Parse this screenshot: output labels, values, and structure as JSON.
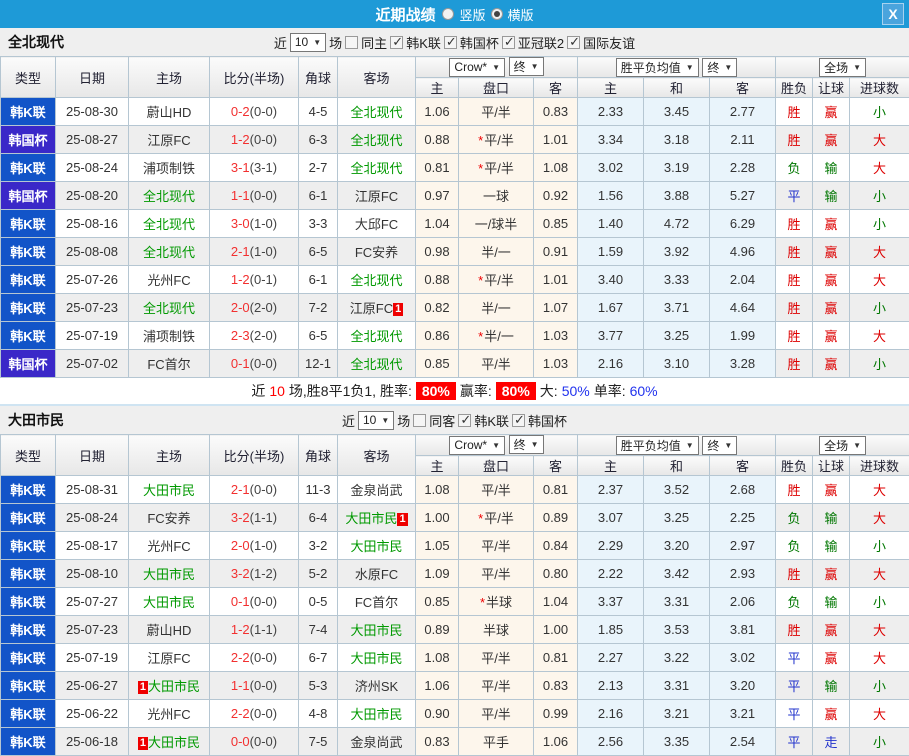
{
  "titlebar": {
    "title": "近期战绩",
    "radio_vertical": "竖版",
    "radio_horizontal": "横版",
    "close_glyph": "X"
  },
  "colors": {
    "titlebar_bg": "#1e9ad7",
    "league_regular": "#1254c8",
    "league_cup": "#3a28c8",
    "target_team": "#009900",
    "score_red": "#f23030",
    "odds_col_bg": "#fdf6ec",
    "mean_col_bg": "#e9f4fb",
    "badge_red": "#ee0000"
  },
  "result_colors": {
    "胜": "#dd0000",
    "负": "#007700",
    "平": "#2233cc",
    "赢": "#dd0000",
    "输": "#007700",
    "走": "#2233cc",
    "大": "#dd0000",
    "小": "#007700"
  },
  "controls": {
    "near": "近",
    "games_value": "10",
    "games": "场",
    "bookmaker": "Crow*",
    "final": "终",
    "mean_label": "胜平负均值",
    "final2": "终",
    "fullmatch": "全场"
  },
  "columns": {
    "type": "类型",
    "date": "日期",
    "home": "主场",
    "score": "比分(半场)",
    "corner": "角球",
    "away": "客场",
    "odds_home": "主",
    "handicap": "盘口",
    "odds_away": "客",
    "mean_home": "主",
    "mean_draw": "和",
    "mean_away": "客",
    "result": "胜负",
    "handicap_result": "让球",
    "goals": "进球数"
  },
  "sections": [
    {
      "team": "全北现代",
      "same_label": "同主",
      "filters": [
        "韩K联",
        "韩国杯",
        "亚冠联2",
        "国际友谊"
      ],
      "rows": [
        {
          "cup": false,
          "league": "韩K联",
          "date": "25-08-30",
          "home": "蔚山HD",
          "home_t": false,
          "score": "0-2",
          "half": "(0-0)",
          "corners": "4-5",
          "away": "全北现代",
          "away_t": true,
          "o1": "1.06",
          "star": false,
          "pan": "平/半",
          "o2": "0.83",
          "m1": "2.33",
          "m2": "3.45",
          "m3": "2.77",
          "res": "胜",
          "rlet": "赢",
          "goal": "小"
        },
        {
          "cup": true,
          "league": "韩国杯",
          "date": "25-08-27",
          "home": "江原FC",
          "home_t": false,
          "score": "1-2",
          "half": "(0-0)",
          "corners": "6-3",
          "away": "全北现代",
          "away_t": true,
          "o1": "0.88",
          "star": true,
          "pan": "平/半",
          "o2": "1.01",
          "m1": "3.34",
          "m2": "3.18",
          "m3": "2.11",
          "res": "胜",
          "rlet": "赢",
          "goal": "大"
        },
        {
          "cup": false,
          "league": "韩K联",
          "date": "25-08-24",
          "home": "浦项制铁",
          "home_t": false,
          "score": "3-1",
          "half": "(3-1)",
          "corners": "2-7",
          "away": "全北现代",
          "away_t": true,
          "o1": "0.81",
          "star": true,
          "pan": "平/半",
          "o2": "1.08",
          "m1": "3.02",
          "m2": "3.19",
          "m3": "2.28",
          "res": "负",
          "rlet": "输",
          "goal": "大"
        },
        {
          "cup": true,
          "league": "韩国杯",
          "date": "25-08-20",
          "home": "全北现代",
          "home_t": true,
          "score": "1-1",
          "half": "(0-0)",
          "corners": "6-1",
          "away": "江原FC",
          "away_t": false,
          "o1": "0.97",
          "star": false,
          "pan": "一球",
          "o2": "0.92",
          "m1": "1.56",
          "m2": "3.88",
          "m3": "5.27",
          "res": "平",
          "rlet": "输",
          "goal": "小"
        },
        {
          "cup": false,
          "league": "韩K联",
          "date": "25-08-16",
          "home": "全北现代",
          "home_t": true,
          "score": "3-0",
          "half": "(1-0)",
          "corners": "3-3",
          "away": "大邱FC",
          "away_t": false,
          "o1": "1.04",
          "star": false,
          "pan": "一/球半",
          "o2": "0.85",
          "m1": "1.40",
          "m2": "4.72",
          "m3": "6.29",
          "res": "胜",
          "rlet": "赢",
          "goal": "小"
        },
        {
          "cup": false,
          "league": "韩K联",
          "date": "25-08-08",
          "home": "全北现代",
          "home_t": true,
          "score": "2-1",
          "half": "(1-0)",
          "corners": "6-5",
          "away": "FC安养",
          "away_t": false,
          "o1": "0.98",
          "star": false,
          "pan": "半/一",
          "o2": "0.91",
          "m1": "1.59",
          "m2": "3.92",
          "m3": "4.96",
          "res": "胜",
          "rlet": "赢",
          "goal": "大"
        },
        {
          "cup": false,
          "league": "韩K联",
          "date": "25-07-26",
          "home": "光州FC",
          "home_t": false,
          "score": "1-2",
          "half": "(0-1)",
          "corners": "6-1",
          "away": "全北现代",
          "away_t": true,
          "o1": "0.88",
          "star": true,
          "pan": "平/半",
          "o2": "1.01",
          "m1": "3.40",
          "m2": "3.33",
          "m3": "2.04",
          "res": "胜",
          "rlet": "赢",
          "goal": "大"
        },
        {
          "cup": false,
          "league": "韩K联",
          "date": "25-07-23",
          "home": "全北现代",
          "home_t": true,
          "score": "2-0",
          "half": "(2-0)",
          "corners": "7-2",
          "away": "江原FC",
          "away_t": false,
          "away_badge": "1",
          "away_badge_pos": "after",
          "o1": "0.82",
          "star": false,
          "pan": "半/一",
          "o2": "1.07",
          "m1": "1.67",
          "m2": "3.71",
          "m3": "4.64",
          "res": "胜",
          "rlet": "赢",
          "goal": "小"
        },
        {
          "cup": false,
          "league": "韩K联",
          "date": "25-07-19",
          "home": "浦项制铁",
          "home_t": false,
          "score": "2-3",
          "half": "(2-0)",
          "corners": "6-5",
          "away": "全北现代",
          "away_t": true,
          "o1": "0.86",
          "star": true,
          "pan": "半/一",
          "o2": "1.03",
          "m1": "3.77",
          "m2": "3.25",
          "m3": "1.99",
          "res": "胜",
          "rlet": "赢",
          "goal": "大"
        },
        {
          "cup": true,
          "league": "韩国杯",
          "date": "25-07-02",
          "home": "FC首尔",
          "home_t": false,
          "score": "0-1",
          "half": "(0-0)",
          "corners": "12-1",
          "away": "全北现代",
          "away_t": true,
          "o1": "0.85",
          "star": false,
          "pan": "平/半",
          "o2": "1.03",
          "m1": "2.16",
          "m2": "3.10",
          "m3": "3.28",
          "res": "胜",
          "rlet": "赢",
          "goal": "小"
        }
      ],
      "summary": {
        "near": "近",
        "count": "10",
        "record": "场,胜8平1负1, 胜率:",
        "win_rate": "80%",
        "profit_label": "赢率:",
        "profit_rate": "80%",
        "big_label": "大:",
        "big_rate": "50%",
        "single_label": "单率:",
        "single_rate": "60%"
      }
    },
    {
      "team": "大田市民",
      "same_label": "同客",
      "filters": [
        "韩K联",
        "韩国杯"
      ],
      "rows": [
        {
          "cup": false,
          "league": "韩K联",
          "date": "25-08-31",
          "home": "大田市民",
          "home_t": true,
          "score": "2-1",
          "half": "(0-0)",
          "corners": "11-3",
          "away": "金泉尚武",
          "away_t": false,
          "o1": "1.08",
          "star": false,
          "pan": "平/半",
          "o2": "0.81",
          "m1": "2.37",
          "m2": "3.52",
          "m3": "2.68",
          "res": "胜",
          "rlet": "赢",
          "goal": "大"
        },
        {
          "cup": false,
          "league": "韩K联",
          "date": "25-08-24",
          "home": "FC安养",
          "home_t": false,
          "score": "3-2",
          "half": "(1-1)",
          "corners": "6-4",
          "away": "大田市民",
          "away_t": true,
          "away_badge": "1",
          "away_badge_pos": "after",
          "o1": "1.00",
          "star": true,
          "pan": "平/半",
          "o2": "0.89",
          "m1": "3.07",
          "m2": "3.25",
          "m3": "2.25",
          "res": "负",
          "rlet": "输",
          "goal": "大"
        },
        {
          "cup": false,
          "league": "韩K联",
          "date": "25-08-17",
          "home": "光州FC",
          "home_t": false,
          "score": "2-0",
          "half": "(1-0)",
          "corners": "3-2",
          "away": "大田市民",
          "away_t": true,
          "o1": "1.05",
          "star": false,
          "pan": "平/半",
          "o2": "0.84",
          "m1": "2.29",
          "m2": "3.20",
          "m3": "2.97",
          "res": "负",
          "rlet": "输",
          "goal": "小"
        },
        {
          "cup": false,
          "league": "韩K联",
          "date": "25-08-10",
          "home": "大田市民",
          "home_t": true,
          "score": "3-2",
          "half": "(1-2)",
          "corners": "5-2",
          "away": "水原FC",
          "away_t": false,
          "o1": "1.09",
          "star": false,
          "pan": "平/半",
          "o2": "0.80",
          "m1": "2.22",
          "m2": "3.42",
          "m3": "2.93",
          "res": "胜",
          "rlet": "赢",
          "goal": "大"
        },
        {
          "cup": false,
          "league": "韩K联",
          "date": "25-07-27",
          "home": "大田市民",
          "home_t": true,
          "score": "0-1",
          "half": "(0-0)",
          "corners": "0-5",
          "away": "FC首尔",
          "away_t": false,
          "o1": "0.85",
          "star": true,
          "pan": "半球",
          "o2": "1.04",
          "m1": "3.37",
          "m2": "3.31",
          "m3": "2.06",
          "res": "负",
          "rlet": "输",
          "goal": "小"
        },
        {
          "cup": false,
          "league": "韩K联",
          "date": "25-07-23",
          "home": "蔚山HD",
          "home_t": false,
          "score": "1-2",
          "half": "(1-1)",
          "corners": "7-4",
          "away": "大田市民",
          "away_t": true,
          "o1": "0.89",
          "star": false,
          "pan": "半球",
          "o2": "1.00",
          "m1": "1.85",
          "m2": "3.53",
          "m3": "3.81",
          "res": "胜",
          "rlet": "赢",
          "goal": "大"
        },
        {
          "cup": false,
          "league": "韩K联",
          "date": "25-07-19",
          "home": "江原FC",
          "home_t": false,
          "score": "2-2",
          "half": "(0-0)",
          "corners": "6-7",
          "away": "大田市民",
          "away_t": true,
          "o1": "1.08",
          "star": false,
          "pan": "平/半",
          "o2": "0.81",
          "m1": "2.27",
          "m2": "3.22",
          "m3": "3.02",
          "res": "平",
          "rlet": "赢",
          "goal": "大"
        },
        {
          "cup": false,
          "league": "韩K联",
          "date": "25-06-27",
          "home": "大田市民",
          "home_t": true,
          "home_badge": "1",
          "home_badge_pos": "before",
          "score": "1-1",
          "half": "(0-0)",
          "corners": "5-3",
          "away": "济州SK",
          "away_t": false,
          "o1": "1.06",
          "star": false,
          "pan": "平/半",
          "o2": "0.83",
          "m1": "2.13",
          "m2": "3.31",
          "m3": "3.20",
          "res": "平",
          "rlet": "输",
          "goal": "小"
        },
        {
          "cup": false,
          "league": "韩K联",
          "date": "25-06-22",
          "home": "光州FC",
          "home_t": false,
          "score": "2-2",
          "half": "(0-0)",
          "corners": "4-8",
          "away": "大田市民",
          "away_t": true,
          "o1": "0.90",
          "star": false,
          "pan": "平/半",
          "o2": "0.99",
          "m1": "2.16",
          "m2": "3.21",
          "m3": "3.21",
          "res": "平",
          "rlet": "赢",
          "goal": "大"
        },
        {
          "cup": false,
          "league": "韩K联",
          "date": "25-06-18",
          "home": "大田市民",
          "home_t": true,
          "home_badge": "1",
          "home_badge_pos": "before",
          "score": "0-0",
          "half": "(0-0)",
          "corners": "7-5",
          "away": "金泉尚武",
          "away_t": false,
          "o1": "0.83",
          "star": false,
          "pan": "平手",
          "o2": "1.06",
          "m1": "2.56",
          "m2": "3.35",
          "m3": "2.54",
          "res": "平",
          "rlet": "走",
          "goal": "小"
        }
      ]
    }
  ]
}
